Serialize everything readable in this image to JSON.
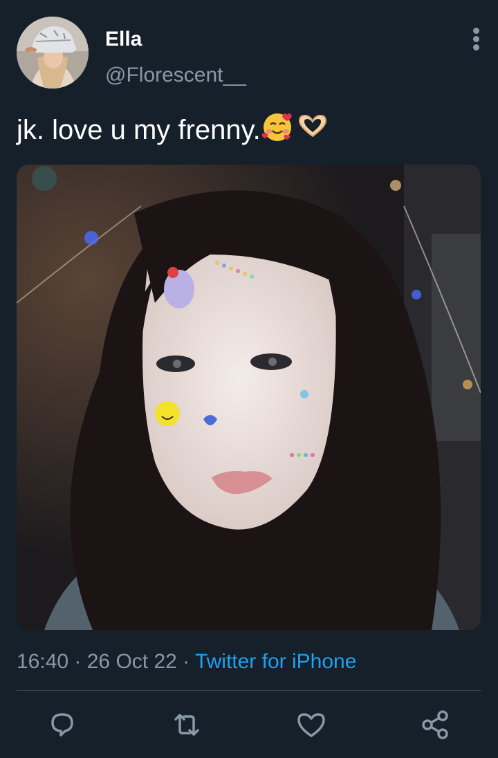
{
  "author": {
    "display_name": "Ella",
    "handle": "@Florescent__"
  },
  "tweet": {
    "text": "jk. love u my frenny.",
    "emojis": [
      "smiling-face-with-hearts",
      "heart-hands"
    ]
  },
  "meta": {
    "time": "16:40",
    "sep1": " · ",
    "date": "26 Oct 22",
    "sep2": " · ",
    "source": "Twitter for iPhone"
  },
  "actions": [
    "reply-icon",
    "retweet-icon",
    "like-icon",
    "share-icon"
  ],
  "colors": {
    "background": "#15202b",
    "secondary_text": "#8899a6",
    "link": "#1da1f2",
    "divider": "#38444d"
  }
}
